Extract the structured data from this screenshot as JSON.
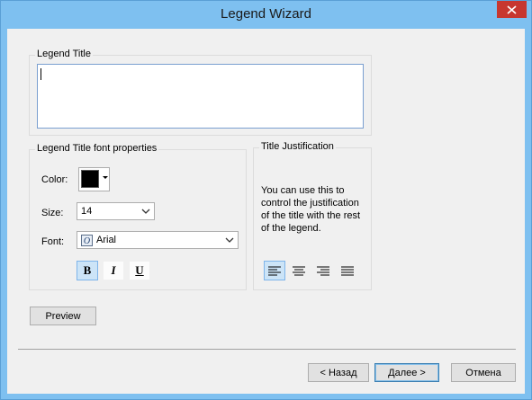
{
  "window": {
    "title": "Legend Wizard"
  },
  "legend_title_group": {
    "label": "Legend Title",
    "value": ""
  },
  "font_group": {
    "label": "Legend Title font properties",
    "color_label": "Color:",
    "color_value": "#000000",
    "size_label": "Size:",
    "size_value": "14",
    "font_label": "Font:",
    "font_value": "Arial",
    "bold_label": "B",
    "italic_label": "I",
    "underline_label": "U",
    "bold_active": true
  },
  "justification_group": {
    "label": "Title Justification",
    "description": "You can use this to control the justification of the title with the rest of the legend.",
    "description_lines": [
      "You can use this to",
      "control the justification",
      "of the title with the rest",
      "of the legend."
    ],
    "selected": "left"
  },
  "buttons": {
    "preview": "Preview",
    "back": "< Назад",
    "next": "Далее >",
    "cancel": "Отмена"
  },
  "colors": {
    "titlebar": "#7ec0f0",
    "close": "#c7372f",
    "selected_bg": "#cce4f7"
  }
}
